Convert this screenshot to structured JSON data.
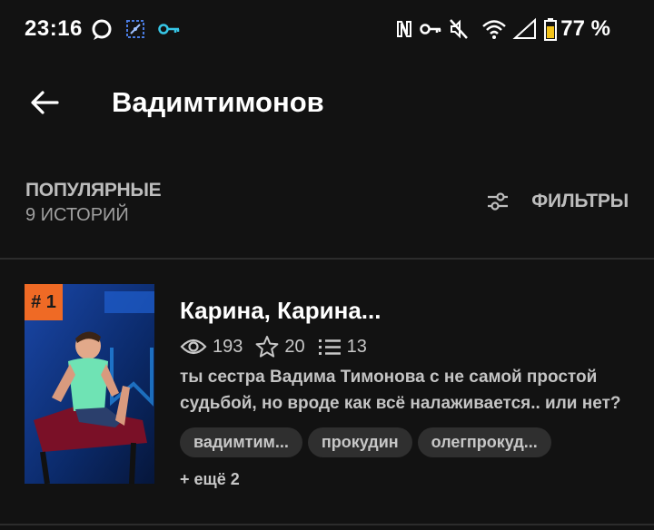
{
  "status_bar": {
    "time": "23:16",
    "battery": "77 %",
    "icons": [
      "chat-icon",
      "app-icon",
      "key-icon",
      "nfc-icon",
      "vpn-key-icon",
      "mute-icon",
      "wifi-icon",
      "signal-icon",
      "battery-icon"
    ]
  },
  "header": {
    "title": "Вадимтимонов",
    "back_icon": "arrow-left-icon"
  },
  "sort": {
    "label": "ПОПУЛЯРНЫЕ",
    "count": "9 ИСТОРИЙ",
    "filters_label": "ФИЛЬТРЫ",
    "filters_icon": "sliders-icon"
  },
  "colors": {
    "background": "#121212",
    "badge": "#ef6a25",
    "tag_bg": "#2f2f2f",
    "muted_text": "#bdbdbd"
  },
  "stories": [
    {
      "rank": "# 1",
      "title": "Карина, Карина...",
      "views": "193",
      "stars": "20",
      "chapters": "13",
      "description": "ты сестра Вадима Тимонова с не самой простой судьбой, но вроде как всё налаживается.. или нет?",
      "tags": [
        "вадимтим...",
        "прокудин",
        "олегпрокуд..."
      ],
      "more_tags": "+ ещё 2"
    }
  ]
}
